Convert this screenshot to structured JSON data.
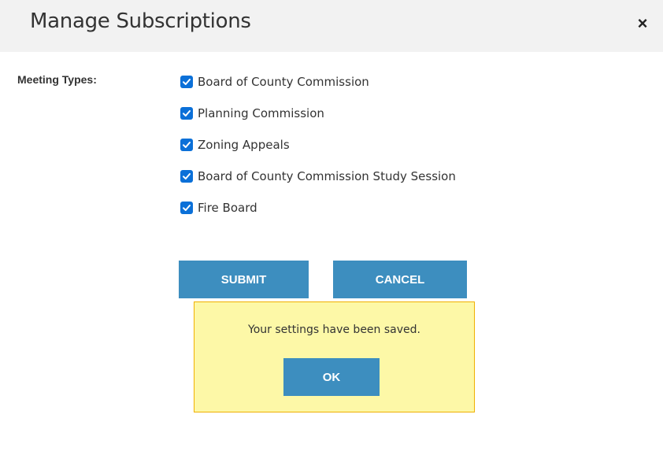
{
  "dialog": {
    "title": "Manage Subscriptions",
    "close_label": "×"
  },
  "form": {
    "meeting_types_label": "Meeting Types:",
    "meeting_types": [
      {
        "label": "Board of County Commission",
        "checked": true
      },
      {
        "label": "Planning Commission",
        "checked": true
      },
      {
        "label": "Zoning Appeals",
        "checked": true
      },
      {
        "label": "Board of County Commission Study Session",
        "checked": true
      },
      {
        "label": "Fire Board",
        "checked": true
      }
    ],
    "submit_label": "SUBMIT",
    "cancel_label": "CANCEL"
  },
  "alert": {
    "message": "Your settings have been saved.",
    "ok_label": "OK"
  },
  "colors": {
    "header_bg": "#f2f2f2",
    "checkbox": "#0b70d8",
    "button": "#3d8ebf",
    "alert_bg": "#fdf8a7",
    "alert_border": "#f0b000"
  }
}
